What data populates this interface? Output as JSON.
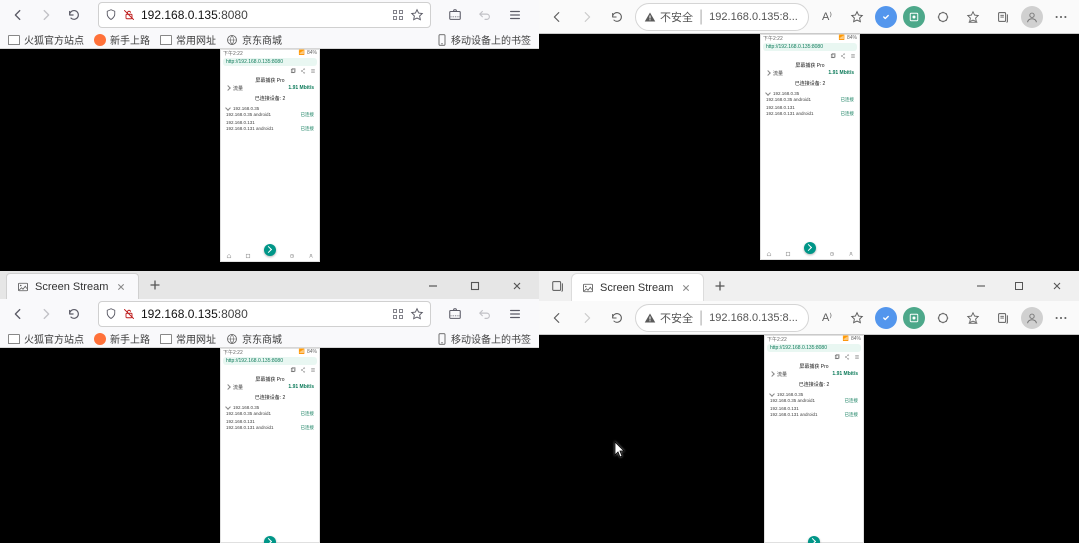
{
  "common": {
    "tab_title": "Screen Stream",
    "url_firefox_host": "192.168.0.135",
    "url_firefox_port": ":8080",
    "url_edge": "192.168.0.135:8...",
    "edge_not_secure": "不安全",
    "edge_readaloud": "A⁾",
    "bookmarks": {
      "b1": "火狐官方站点",
      "b2": "新手上路",
      "b3": "常用网址",
      "b4": "京东商城",
      "right": "移动设备上的书签"
    }
  },
  "phone": {
    "status_left": "下午2:22",
    "status_net": "📶",
    "status_batt": "84%",
    "addr_url": "http://192.168.0.135:8080",
    "section_title1": "屏幕捕获 Pro",
    "row1_label": "流量",
    "row1_value": "1.91 Mbit/s",
    "section_title2": "已连接设备: 2",
    "client_a_ip": "192.168.0.35",
    "client_a_ua": "192.168.0.35 android1",
    "client_b_ip": "192.168.0.131",
    "client_b_ua": "192.168.0.131 android1",
    "client_state": "已连接"
  }
}
